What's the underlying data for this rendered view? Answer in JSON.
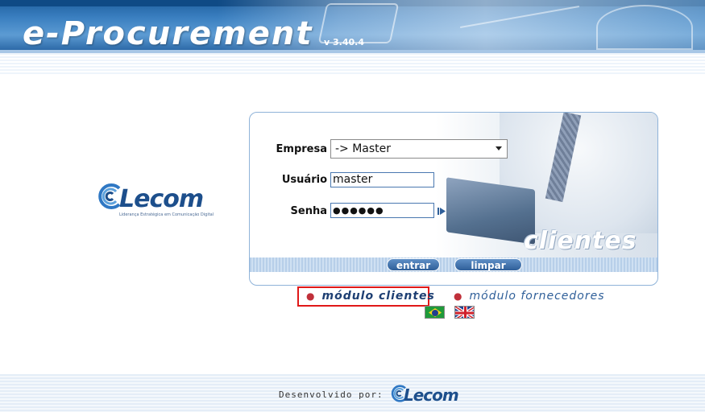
{
  "header": {
    "title": "e-Procurement",
    "version": "v 3.40.4"
  },
  "brand": {
    "logo_text": "Lecom",
    "logo_tagline": "Liderança Estratégica em Comunicação Digital"
  },
  "login": {
    "empresa_label": "Empresa",
    "empresa_value": "-> Master",
    "usuario_label": "Usuário",
    "usuario_value": "master",
    "senha_label": "Senha",
    "senha_value": "●●●●●●",
    "panel_watermark": "clientes",
    "entrar_label": "entrar",
    "limpar_label": "limpar"
  },
  "modules": {
    "clientes": "módulo clientes",
    "fornecedores": "módulo fornecedores"
  },
  "languages": [
    {
      "name": "Português (Brasil)",
      "icon": "brazil-flag-icon"
    },
    {
      "name": "English",
      "icon": "uk-flag-icon"
    }
  ],
  "footer": {
    "developed_by": "Desenvolvido por:",
    "logo_text": "Lecom"
  },
  "colors": {
    "brand_blue": "#1d4f8c",
    "header_blue": "#3a7fc0",
    "highlight_red": "#e01818",
    "bullet_red": "#c0303a"
  }
}
